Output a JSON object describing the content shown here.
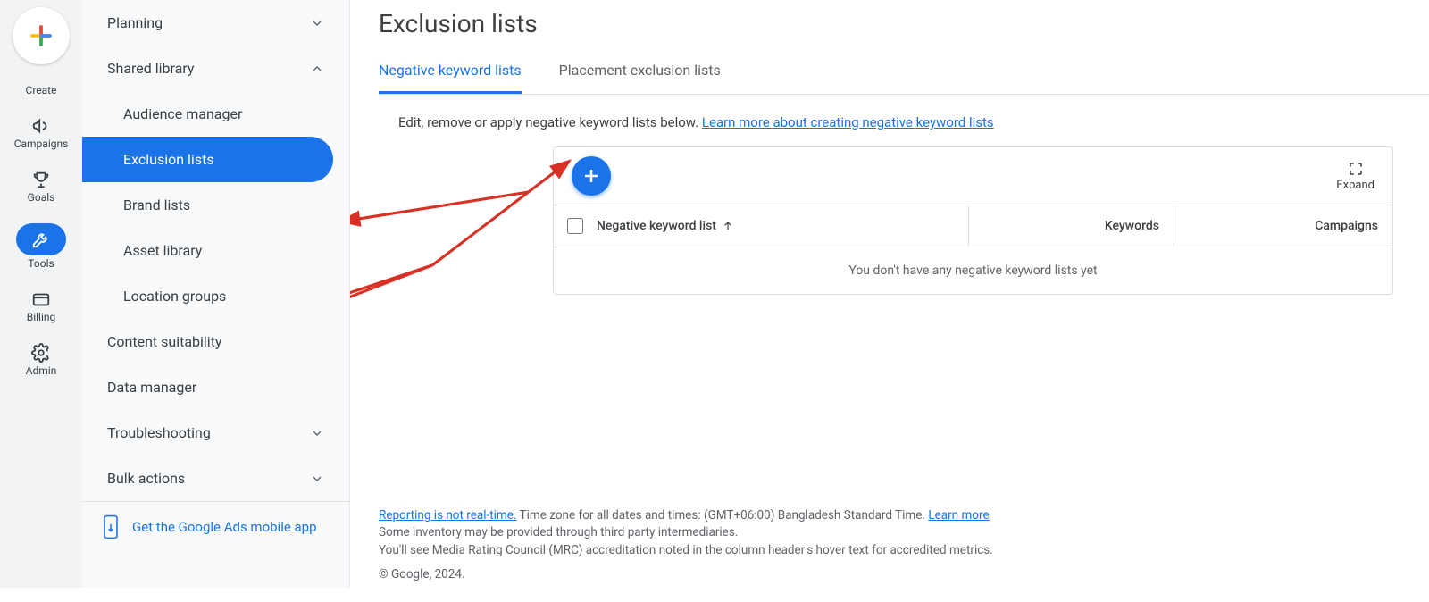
{
  "rail": {
    "create": "Create",
    "campaigns": "Campaigns",
    "goals": "Goals",
    "tools": "Tools",
    "billing": "Billing",
    "admin": "Admin"
  },
  "sidebar": {
    "planning": "Planning",
    "shared_library": "Shared library",
    "audience_manager": "Audience manager",
    "exclusion_lists": "Exclusion lists",
    "brand_lists": "Brand lists",
    "asset_library": "Asset library",
    "location_groups": "Location groups",
    "content_suitability": "Content suitability",
    "data_manager": "Data manager",
    "troubleshooting": "Troubleshooting",
    "bulk_actions": "Bulk actions",
    "mobile_app": "Get the Google Ads mobile app"
  },
  "page": {
    "title": "Exclusion lists",
    "tab_neg": "Negative keyword lists",
    "tab_place": "Placement exclusion lists",
    "desc": "Edit, remove or apply negative keyword lists below. ",
    "desc_link": "Learn more about creating negative keyword lists",
    "expand": "Expand",
    "col_name": "Negative keyword list",
    "col_kw": "Keywords",
    "col_camp": "Campaigns",
    "empty": "You don't have any negative keyword lists yet"
  },
  "footer": {
    "reporting": "Reporting is not real-time.",
    "tz": " Time zone for all dates and times: (GMT+06:00) Bangladesh Standard Time. ",
    "learn": "Learn more",
    "line2": "Some inventory may be provided through third party intermediaries.",
    "line3": "You'll see Media Rating Council (MRC) accreditation noted in the column header's hover text for accredited metrics.",
    "copy": "© Google, 2024."
  }
}
